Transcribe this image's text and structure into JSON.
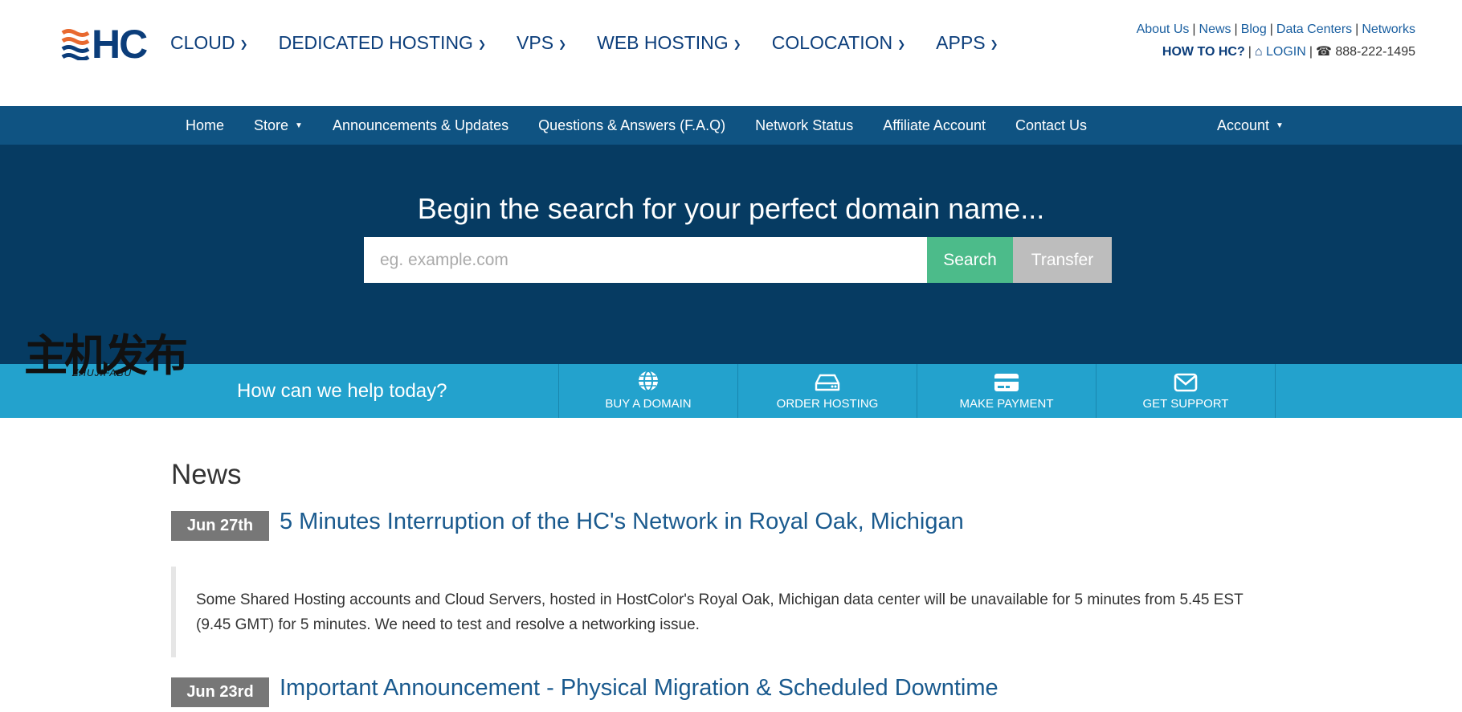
{
  "header": {
    "logo_text": "HC",
    "main_nav": [
      {
        "label": "CLOUD"
      },
      {
        "label": "DEDICATED HOSTING"
      },
      {
        "label": "VPS"
      },
      {
        "label": "WEB HOSTING"
      },
      {
        "label": "COLOCATION"
      },
      {
        "label": "APPS"
      }
    ],
    "utility": {
      "links": [
        "About Us",
        "News",
        "Blog",
        "Data Centers",
        "Networks"
      ],
      "how_to": "HOW TO HC?",
      "login": "LOGIN",
      "phone": "888-222-1495"
    }
  },
  "sub_nav": {
    "items": [
      {
        "label": "Home"
      },
      {
        "label": "Store"
      },
      {
        "label": "Announcements & Updates"
      },
      {
        "label": "Questions & Answers (F.A.Q)"
      },
      {
        "label": "Network Status"
      },
      {
        "label": "Affiliate Account"
      },
      {
        "label": "Contact Us"
      }
    ],
    "account": "Account"
  },
  "hero": {
    "title": "Begin the search for your perfect domain name...",
    "search_placeholder": "eg. example.com",
    "search_button": "Search",
    "transfer_button": "Transfer"
  },
  "help_bar": {
    "text": "How can we help today?",
    "tiles": [
      {
        "label": "BUY A DOMAIN",
        "icon": "globe-icon"
      },
      {
        "label": "ORDER HOSTING",
        "icon": "server-icon"
      },
      {
        "label": "MAKE PAYMENT",
        "icon": "credit-card-icon"
      },
      {
        "label": "GET SUPPORT",
        "icon": "envelope-icon"
      }
    ]
  },
  "watermark": {
    "main": "主机发布",
    "sub": "ZHUJIFABU"
  },
  "news": {
    "title": "News",
    "items": [
      {
        "date": "Jun 27th",
        "title": "5 Minutes Interruption of the HC's Network in Royal Oak, Michigan",
        "excerpt": "Some Shared Hosting accounts and Cloud Servers, hosted in HostColor's Royal Oak, Michigan data center will be unavailable for 5 minutes from 5.45 EST (9.45 GMT) for 5 minutes. We need to test and resolve a networking issue."
      },
      {
        "date": "Jun 23rd",
        "title": "Important Announcement - Physical Migration & Scheduled Downtime"
      }
    ]
  },
  "colors": {
    "brand_navy": "#0b3d7a",
    "subnav": "#0f5382",
    "hero": "#063b62",
    "help_bar": "#23a2cd",
    "search_green": "#4cbb8a",
    "transfer_gray": "#bdbdbd",
    "logo_orange": "#e8692f"
  }
}
